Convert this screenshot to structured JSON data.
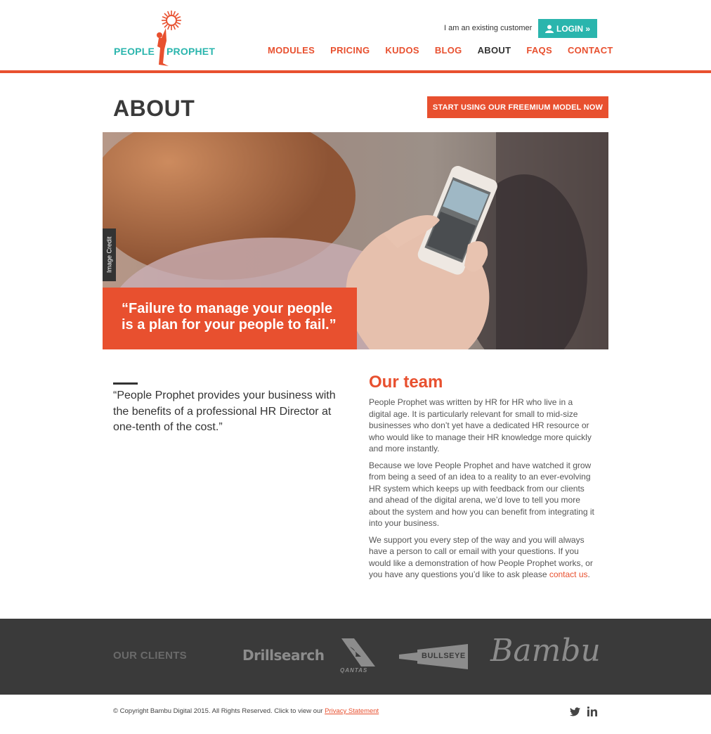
{
  "brand": {
    "name_part1": "PEOPLE",
    "name_part2": "PROPHET",
    "accent_color": "#e8502f",
    "teal_color": "#2ab5ad"
  },
  "header": {
    "customer_text": "I am an existing customer",
    "login_label": "LOGIN »",
    "nav": [
      {
        "label": "MODULES"
      },
      {
        "label": "PRICING"
      },
      {
        "label": "KUDOS"
      },
      {
        "label": "BLOG"
      },
      {
        "label": "ABOUT",
        "active": true
      },
      {
        "label": "FAQS"
      },
      {
        "label": "CONTACT"
      }
    ]
  },
  "page": {
    "title": "ABOUT",
    "cta_label": "START USING OUR FREEMIUM MODEL NOW"
  },
  "hero": {
    "image_credit": "Image Credit",
    "quote": "“Failure to manage your people is a plan for your people to fail.”"
  },
  "intro": {
    "quote": "“People Prophet provides your business with the benefits of a professional HR Director at one-tenth of the cost.”"
  },
  "team": {
    "title": "Our team",
    "p1": "People Prophet was written by HR for HR who live in a digital age. It is particularly relevant for small to mid-size businesses who don’t yet have a dedicated HR resource or who would like to manage their HR knowledge more quickly and more instantly.",
    "p2": "Because we love People Prophet and have watched it grow from being a seed of an idea to a reality to an ever-evolving HR system which keeps up with feedback from our clients and ahead of the digital arena, we’d love to tell you more about the system and how you can benefit from integrating it into your business.",
    "p3_text": "We support you every step of the way and you will always have a person to call or email with your questions. If you would like a demonstration of how People Prophet works, or you have any questions you’d like to ask please ",
    "p3_link": "contact us",
    "p3_end": "."
  },
  "clients": {
    "label": "OUR CLIENTS",
    "logos": [
      {
        "name": "Drillsearch",
        "icon": "drillsearch-logo"
      },
      {
        "name": "QANTAS",
        "icon": "qantas-logo"
      },
      {
        "name": "BULLSEYE",
        "icon": "bullseye-logo"
      },
      {
        "name": "Bambu",
        "icon": "bambu-logo"
      }
    ]
  },
  "footer": {
    "copyright": "© Copyright Bambu Digital 2015. All Rights Reserved. Click to view our ",
    "privacy_label": "Privacy Statement",
    "social": [
      {
        "icon": "twitter-icon"
      },
      {
        "icon": "linkedin-icon"
      }
    ]
  }
}
